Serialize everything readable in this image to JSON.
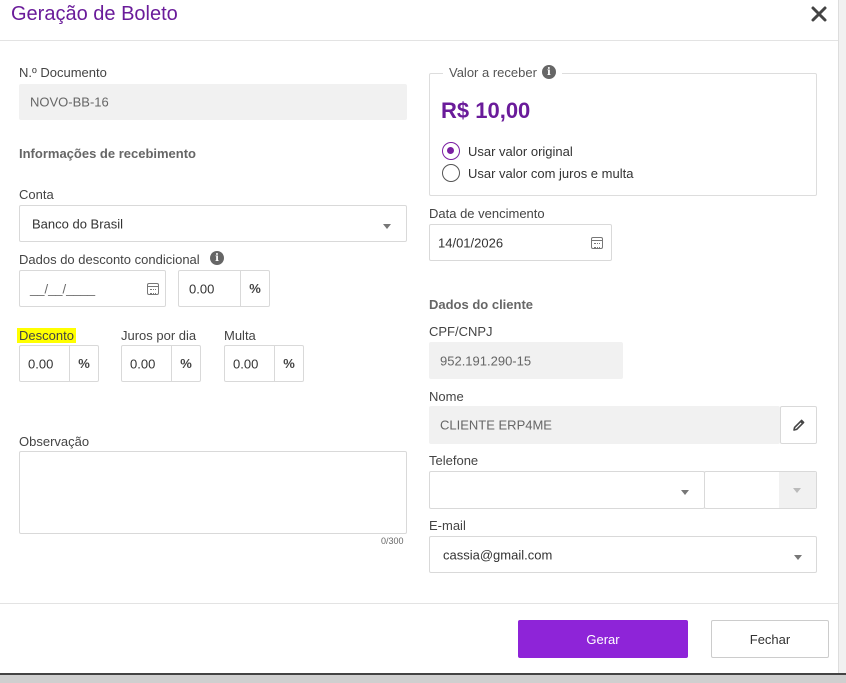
{
  "dialog": {
    "title": "Geração de Boleto",
    "close_icon": "close-icon"
  },
  "left": {
    "documento_label": "N.º Documento",
    "documento_value": "NOVO-BB-16",
    "section_recebimento": "Informações de recebimento",
    "conta_label": "Conta",
    "conta_value": "Banco do Brasil",
    "desconto_condicional_label": "Dados do desconto condicional",
    "desconto_condicional_date_placeholder": "__/__/____",
    "desconto_condicional_value": "0.00",
    "percent_symbol": "%",
    "desconto_label": "Desconto",
    "desconto_value": "0.00",
    "juros_label": "Juros por dia",
    "juros_value": "0.00",
    "multa_label": "Multa",
    "multa_value": "0.00",
    "observacao_label": "Observação",
    "observacao_value": "",
    "observacao_counter": "0/300"
  },
  "right": {
    "valor_label": "Valor a receber",
    "valor_amount": "R$ 10,00",
    "radio_original": "Usar valor original",
    "radio_juros": "Usar valor com juros e multa",
    "radio_selected": "original",
    "vencimento_label": "Data de vencimento",
    "vencimento_value": "14/01/2026",
    "section_cliente": "Dados do cliente",
    "cpf_label": "CPF/CNPJ",
    "cpf_value": "952.191.290-15",
    "nome_label": "Nome",
    "nome_value": "CLIENTE ERP4ME",
    "telefone_label": "Telefone",
    "telefone_value": "",
    "email_label": "E-mail",
    "email_value": "cassia@gmail.com"
  },
  "footer": {
    "gerar_label": "Gerar",
    "fechar_label": "Fechar"
  },
  "colors": {
    "title": "#6a1b9a",
    "primary_button": "#8e24d8",
    "highlight": "#ffff00"
  }
}
